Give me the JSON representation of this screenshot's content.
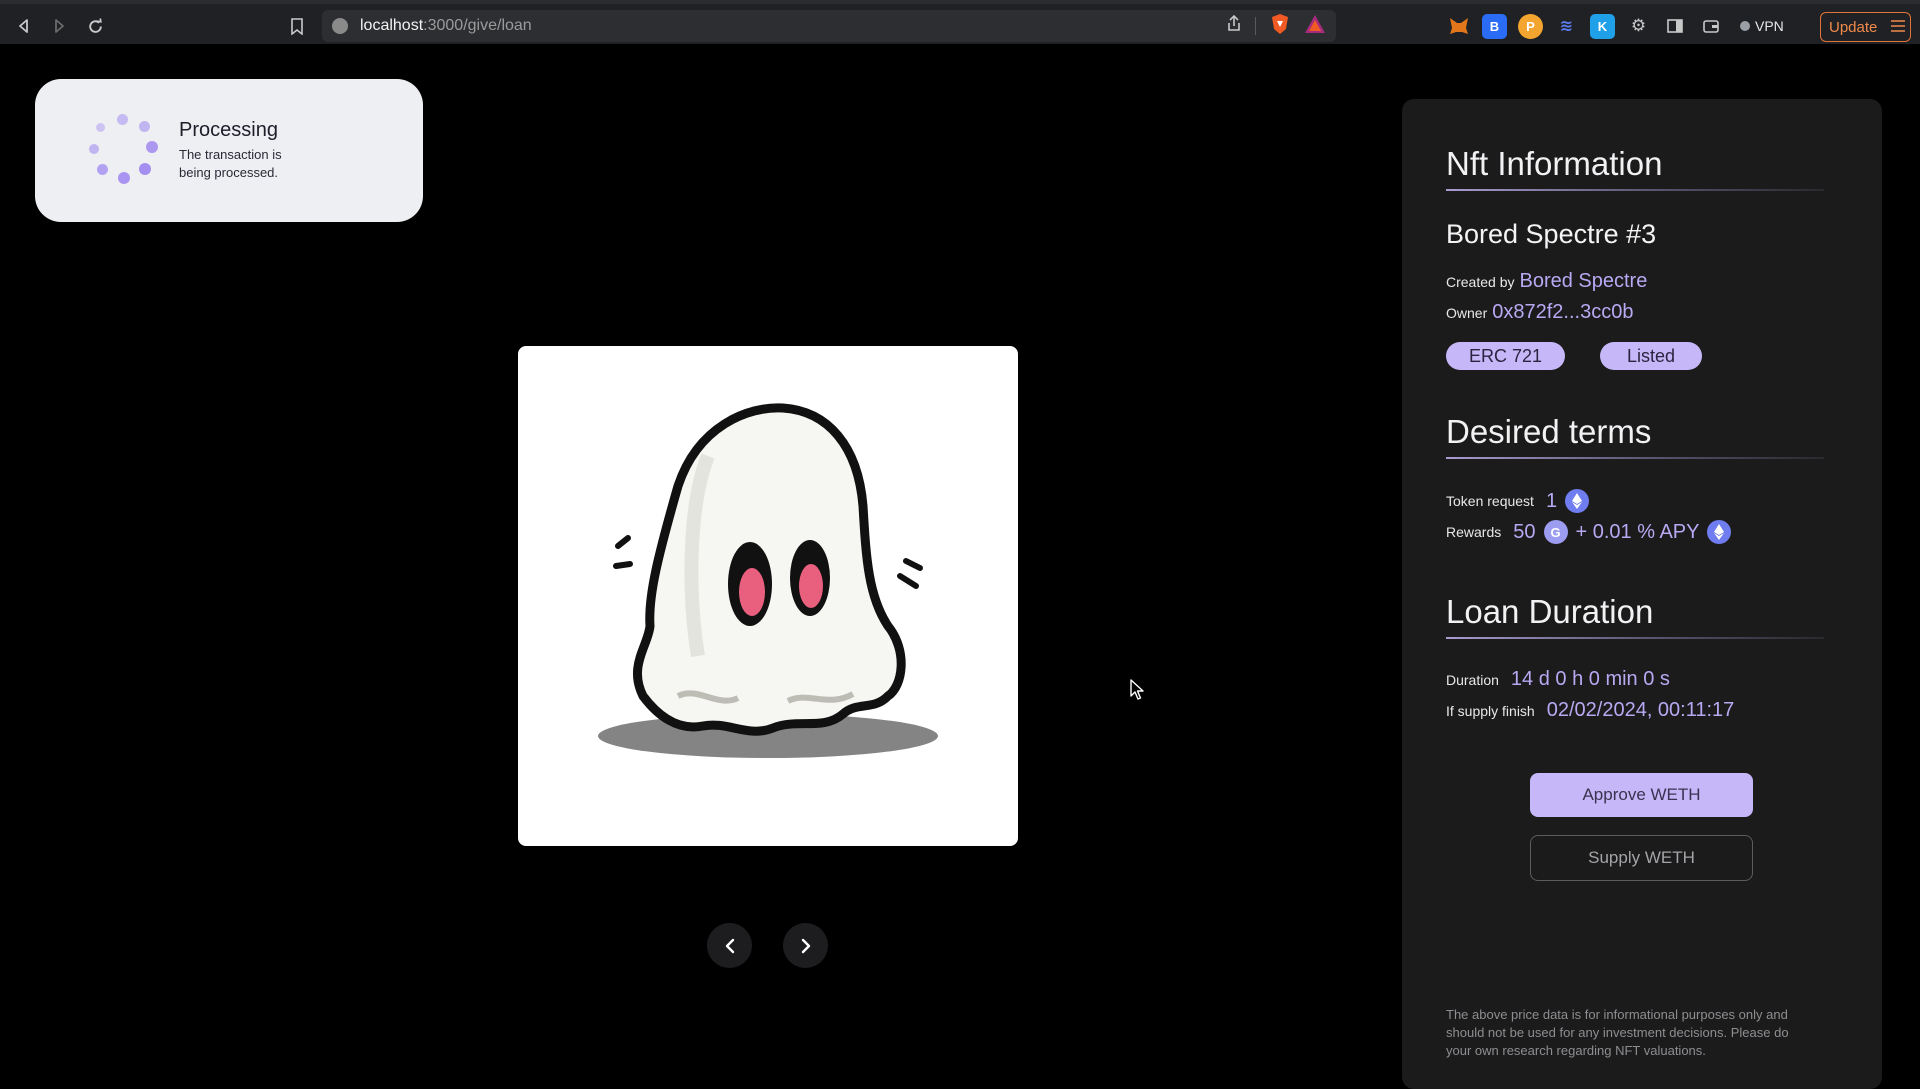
{
  "browser": {
    "url_host": "localhost",
    "url_path": ":3000/give/loan",
    "vpn_label": "VPN",
    "update_label": "Update"
  },
  "toast": {
    "title": "Processing",
    "message": "The transaction is being processed."
  },
  "carousel": {
    "prev_icon": "chevron-left-icon",
    "next_icon": "chevron-right-icon"
  },
  "nft_info": {
    "heading": "Nft Information",
    "name": "Bored Spectre #3",
    "created_by_label": "Created by",
    "created_by_value": "Bored Spectre",
    "owner_label": "Owner",
    "owner_value": "0x872f2...3cc0b",
    "standard_badge": "ERC 721",
    "status_badge": "Listed"
  },
  "desired_terms": {
    "heading": "Desired terms",
    "token_request_label": "Token request",
    "token_request_value": "1",
    "rewards_label": "Rewards",
    "rewards_value": "50",
    "rewards_apy": "+ 0.01 % APY"
  },
  "loan_duration": {
    "heading": "Loan Duration",
    "duration_label": "Duration",
    "duration_value": "14 d 0 h 0 min 0 s",
    "supply_finish_label": "If supply finish",
    "supply_finish_value": "02/02/2024, 00:11:17"
  },
  "actions": {
    "approve_label": "Approve WETH",
    "supply_label": "Supply WETH"
  },
  "disclaimer": "The above price data is for informational purposes only and should not be used for any investment decisions. Please do your own research regarding NFT valuations.",
  "colors": {
    "accent": "#c6b8f8",
    "accent_text": "#b9a8f2",
    "panel_bg": "#1b1b1c",
    "page_bg": "#000000"
  }
}
